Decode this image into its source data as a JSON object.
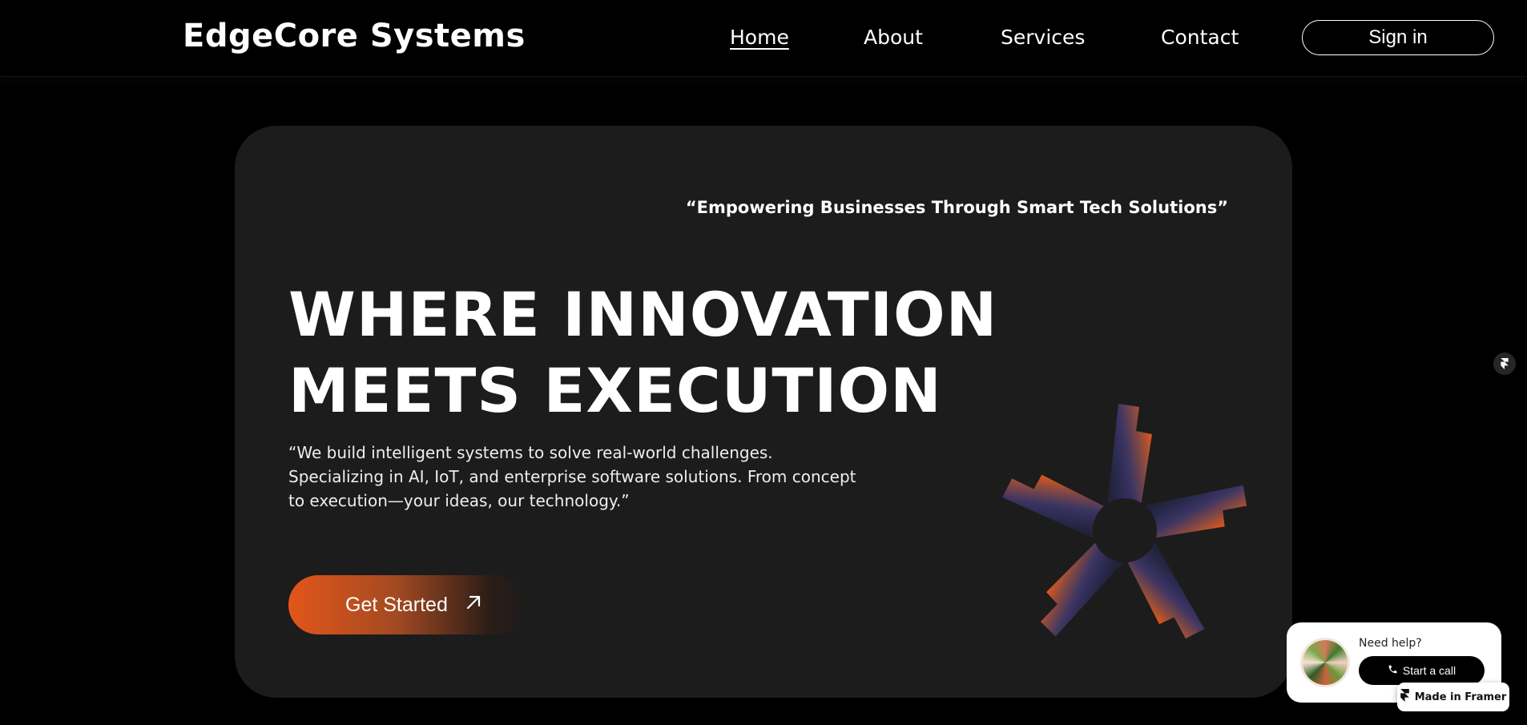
{
  "header": {
    "brand": "EdgeCore Systems",
    "nav": [
      {
        "label": "Home",
        "active": true
      },
      {
        "label": "About",
        "active": false
      },
      {
        "label": "Services",
        "active": false
      },
      {
        "label": "Contact",
        "active": false
      }
    ],
    "signin_label": "Sign in"
  },
  "hero": {
    "tagline": "“Empowering Businesses Through Smart Tech Solutions”",
    "headline_line1": "WHERE INNOVATION",
    "headline_line2": "MEETS EXECUTION",
    "description": "“We build intelligent systems to solve real-world challenges. Specializing in AI, IoT, and enterprise software solutions. From concept to execution—your ideas, our technology.”",
    "cta_label": "Get Started",
    "cta_icon": "arrow-up-right-icon",
    "star_gradient": {
      "start": "#2a2f6e",
      "end": "#e2561a"
    }
  },
  "help_widget": {
    "title": "Need help?",
    "call_label": "Start a call",
    "call_icon": "phone-icon"
  },
  "badge": {
    "label": "Made in Framer",
    "icon": "framer-icon"
  },
  "colors": {
    "background": "#000000",
    "card": "#1c1c1c",
    "accent": "#e2561a"
  }
}
